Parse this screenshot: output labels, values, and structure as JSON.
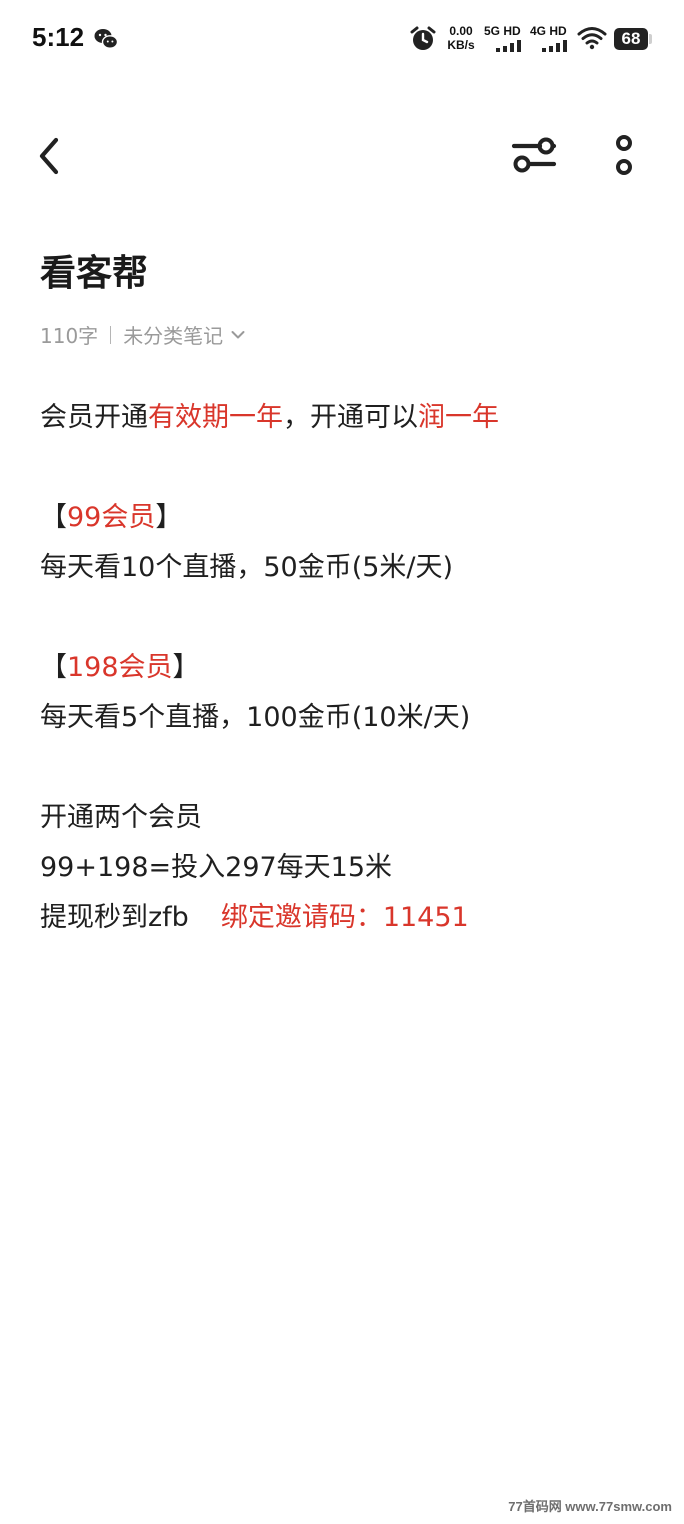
{
  "status_bar": {
    "time": "5:12",
    "net_speed_value": "0.00",
    "net_speed_unit": "KB/s",
    "signal_1_label": "5G HD",
    "signal_2_label": "4G HD",
    "battery_level": "68"
  },
  "note": {
    "title": "看客帮",
    "word_count": "110字",
    "category": "未分类笔记",
    "line_1": {
      "a": "会员开通",
      "b": "有效期一年",
      "c": "，开通可以",
      "d": "润一年"
    },
    "line_2": {
      "open": "【",
      "label": "99会员",
      "close": "】"
    },
    "line_3": "每天看10个直播，50金币(5米/天)",
    "line_4": {
      "open": "【",
      "label": "198会员",
      "close": "】"
    },
    "line_5": "每天看5个直播，100金币(10米/天)",
    "line_6": "开通两个会员",
    "line_7": "99+198=投入297每天15米",
    "line_8": {
      "a": "提现秒到zfb",
      "b": "绑定邀请码：11451"
    }
  },
  "watermark": "77首码网 www.77smw.com",
  "colors": {
    "accent_red": "#d9362b",
    "text": "#1f1f1f",
    "meta_gray": "#9a9a9a"
  }
}
